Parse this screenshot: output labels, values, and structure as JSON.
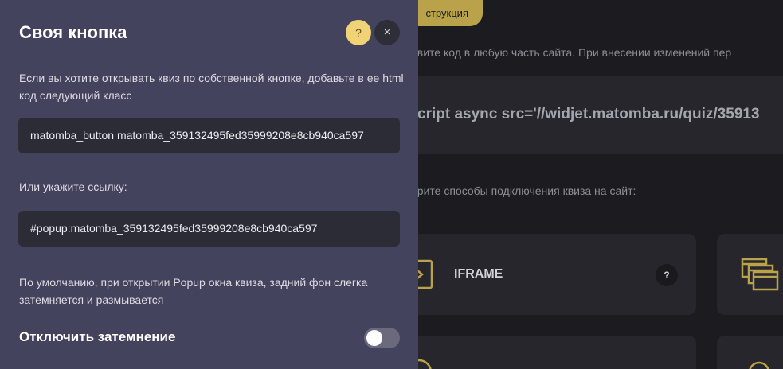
{
  "background": {
    "instructions_button": "струкция",
    "install_text": "овите код в любую часть сайта. При внесении изменений пер",
    "code_snippet": "cript async src='//widjet.matomba.ru/quiz/35913",
    "methods_text": "ерите способы подключения квиза на сайт:",
    "iframe_card": {
      "label": "IFRAME",
      "help": "?"
    }
  },
  "modal": {
    "title": "Своя кнопка",
    "help_label": "?",
    "close_label": "×",
    "description": "Если вы хотите открывать квиз по собственной кнопке, добавьте в ее html код следующий класс",
    "class_value": "matomba_button matomba_359132495fed35999208e8cb940ca597",
    "link_label": "Или укажите ссылку:",
    "link_value": "#popup:matomba_359132495fed35999208e8cb940ca597",
    "note": "По умолчанию, при открытии Popup окна квиза, задний фон слегка затемняется и размывается",
    "toggle_label": "Отключить затемнение",
    "toggle_on": false
  },
  "colors": {
    "accent": "#b9a24a",
    "panel_bg": "#44435d",
    "page_bg": "#1c1c20"
  }
}
